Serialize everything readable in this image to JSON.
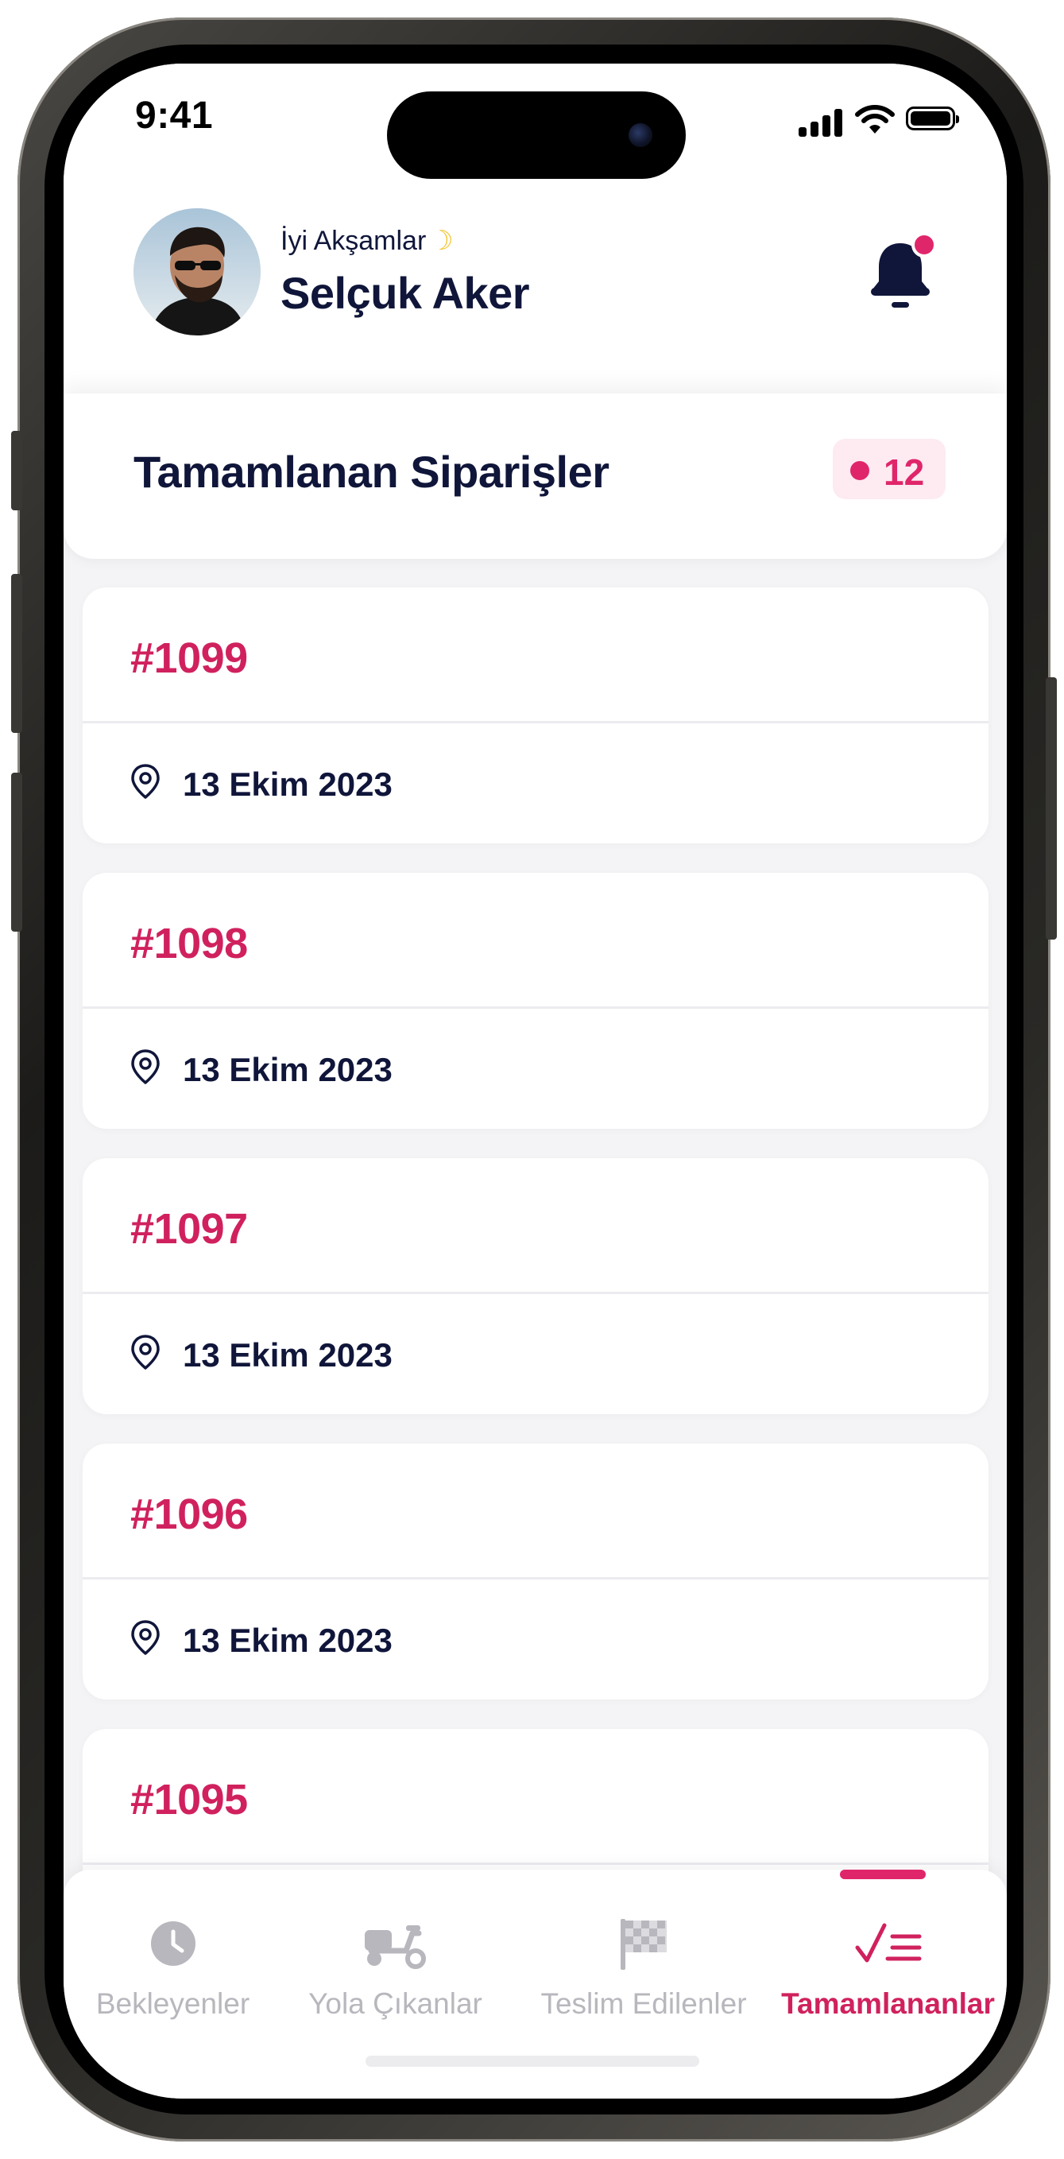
{
  "status_bar": {
    "time": "9:41"
  },
  "header": {
    "greeting": "İyi Akşamlar",
    "user_name": "Selçuk Aker",
    "avatar": "avatar-photo",
    "notification_icon": "bell-icon",
    "has_unread": true
  },
  "section": {
    "title": "Tamamlanan Siparişler",
    "count": "12"
  },
  "orders": [
    {
      "id": "#1099",
      "date": "13 Ekim 2023"
    },
    {
      "id": "#1098",
      "date": "13 Ekim 2023"
    },
    {
      "id": "#1097",
      "date": "13 Ekim 2023"
    },
    {
      "id": "#1096",
      "date": "13 Ekim 2023"
    },
    {
      "id": "#1095",
      "date": ""
    }
  ],
  "tabs": [
    {
      "label": "Bekleyenler",
      "icon": "clock-icon",
      "active": false
    },
    {
      "label": "Yola Çıkanlar",
      "icon": "scooter-icon",
      "active": false
    },
    {
      "label": "Teslim Edilenler",
      "icon": "checkered-flag-icon",
      "active": false
    },
    {
      "label": "Tamamlananlar",
      "icon": "checklist-icon",
      "active": true
    }
  ],
  "colors": {
    "accent": "#d0215e",
    "text_dark": "#10163a",
    "tab_inactive": "#b7b7bd",
    "badge_bg": "#fdebf1"
  }
}
